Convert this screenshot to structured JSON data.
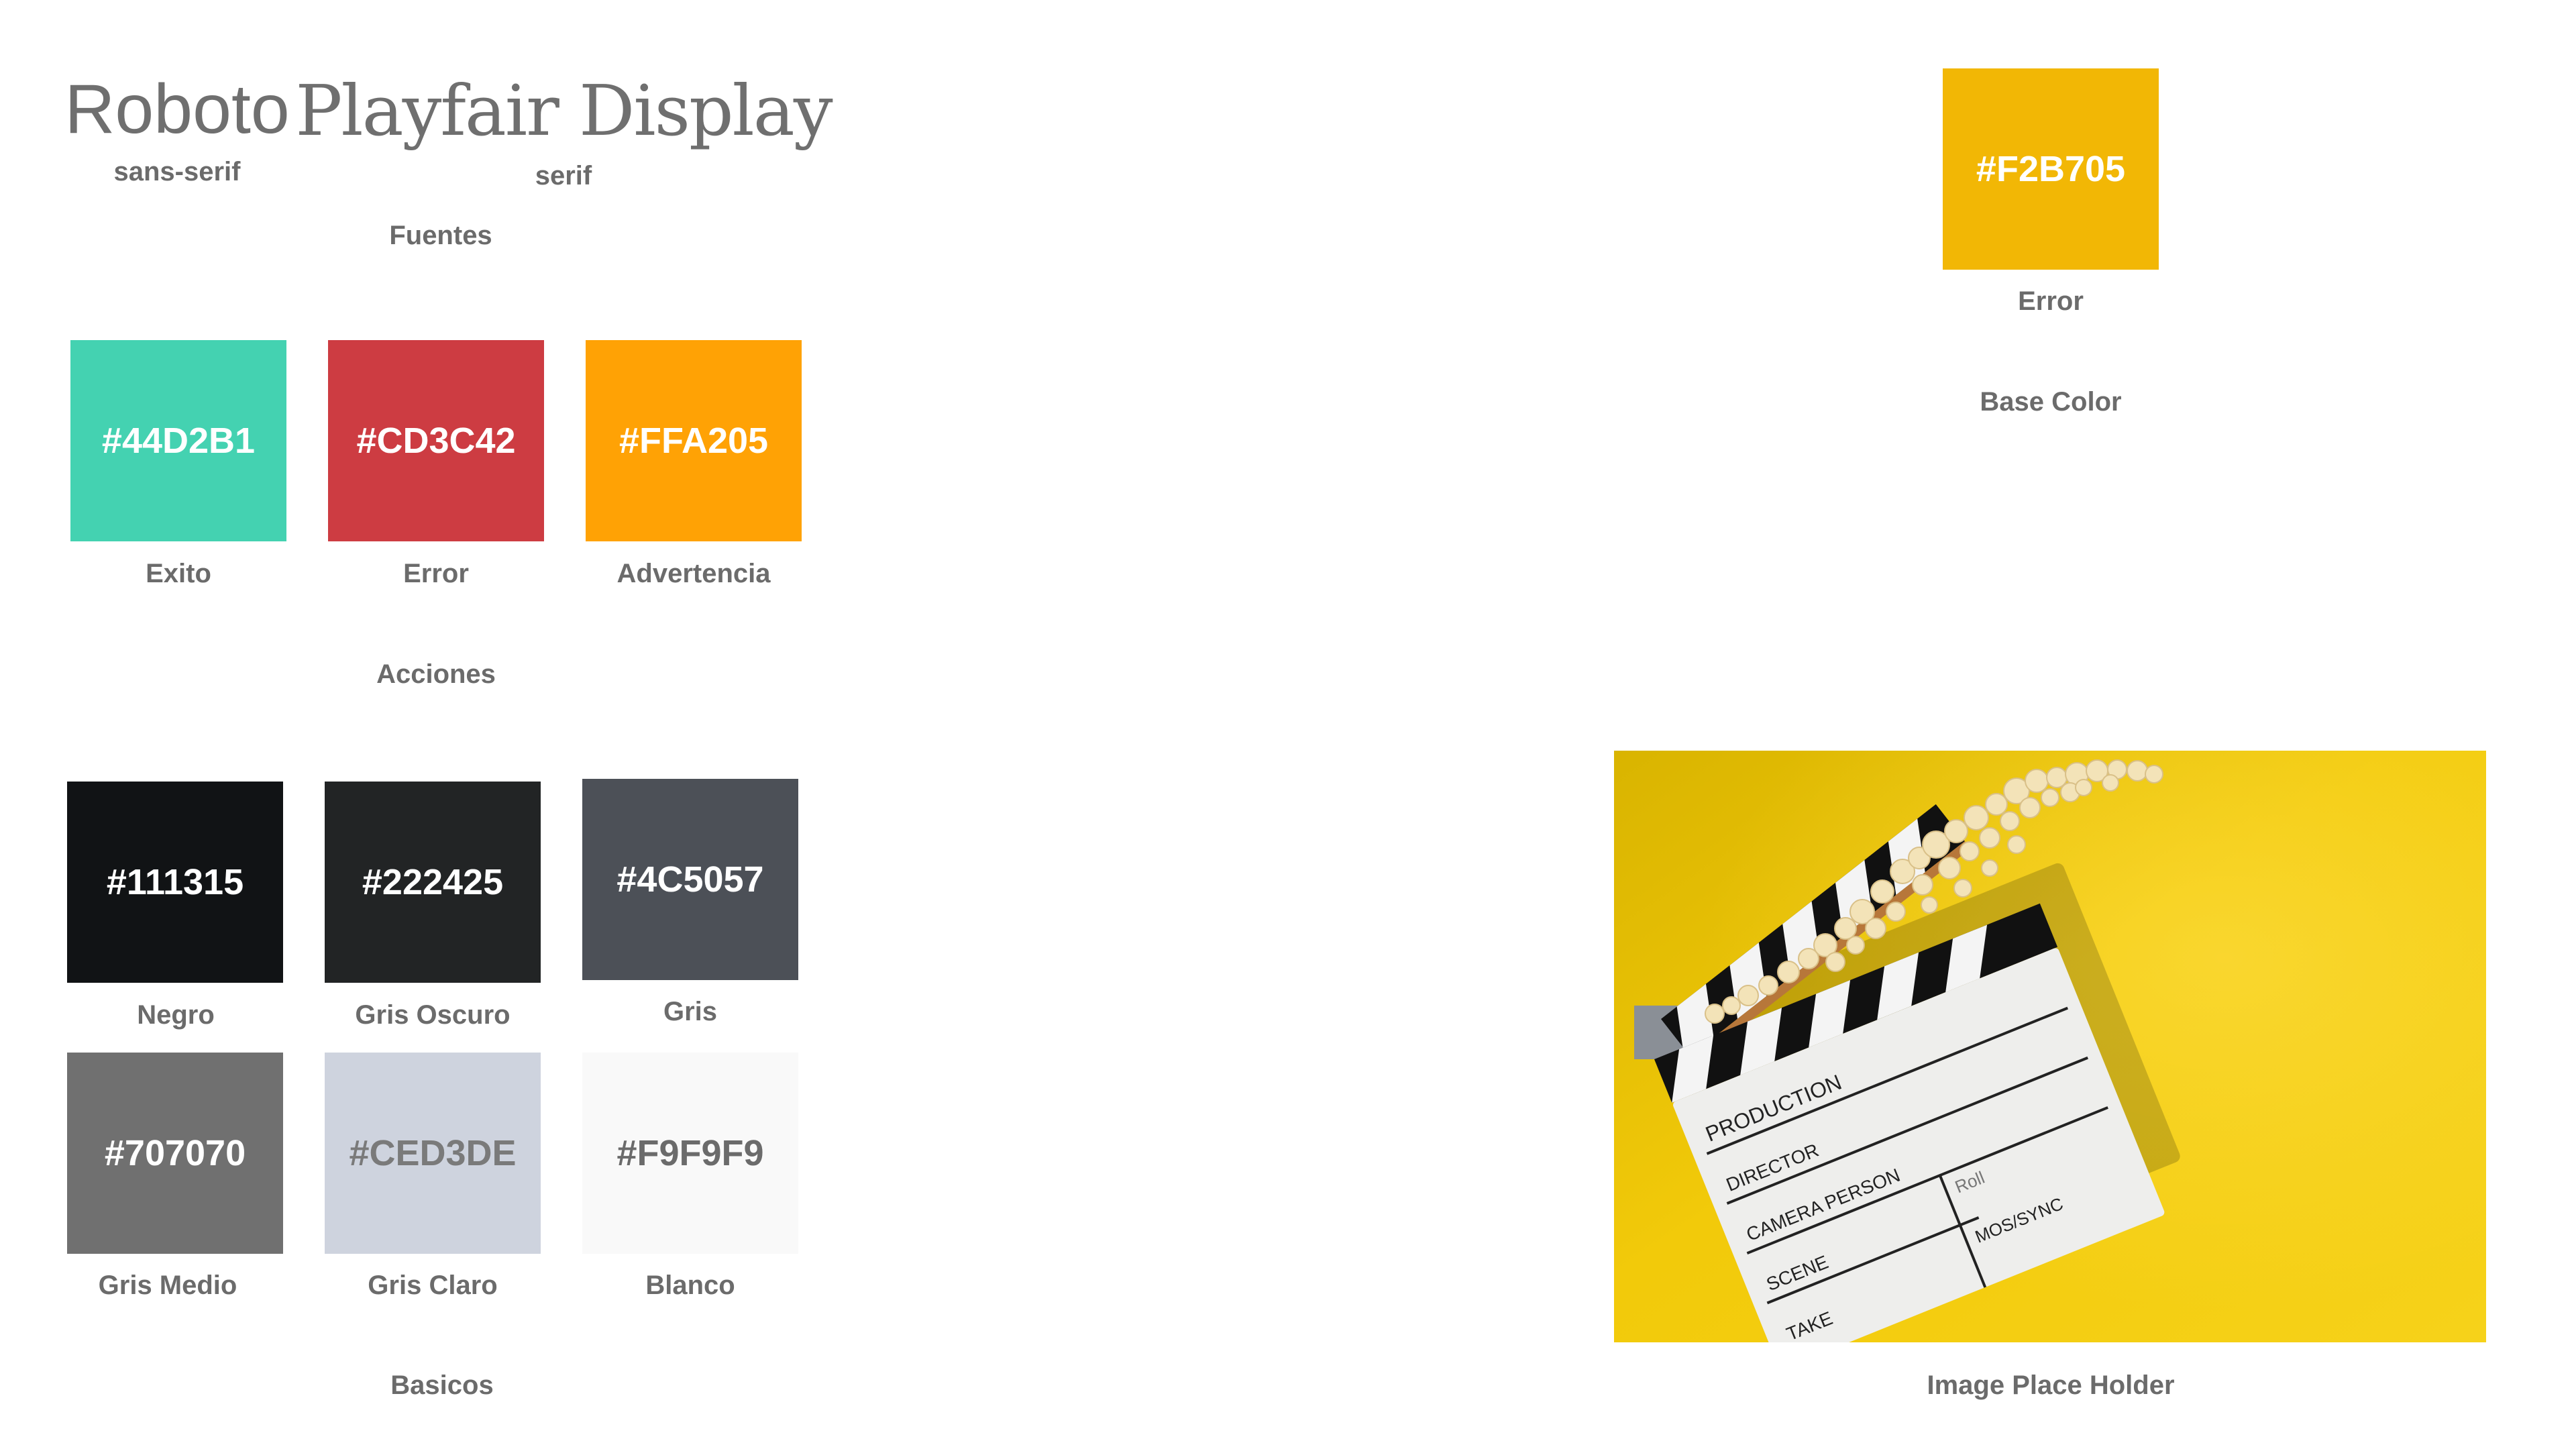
{
  "fonts": {
    "title": "Fuentes",
    "items": [
      {
        "name": "Roboto",
        "category": "sans-serif"
      },
      {
        "name": "Playfair Display",
        "category": "serif"
      }
    ]
  },
  "actions": {
    "title": "Acciones",
    "swatches": [
      {
        "hex": "#44D2B1",
        "label": "Exito",
        "color": "#44D2B1",
        "text_color": "#ffffff"
      },
      {
        "hex": "#CD3C42",
        "label": "Error",
        "color": "#CD3C42",
        "text_color": "#ffffff"
      },
      {
        "hex": "#FFA205",
        "label": "Advertencia",
        "color": "#FFA205",
        "text_color": "#ffffff"
      }
    ]
  },
  "basics": {
    "title": "Basicos",
    "swatches": [
      {
        "hex": "#111315",
        "label": "Negro",
        "color": "#111315",
        "text_color": "#ffffff"
      },
      {
        "hex": "#222425",
        "label": "Gris Oscuro",
        "color": "#222425",
        "text_color": "#ffffff"
      },
      {
        "hex": "#4C5057",
        "label": "Gris",
        "color": "#4C5057",
        "text_color": "#ffffff"
      },
      {
        "hex": "#707070",
        "label": "Gris Medio",
        "color": "#707070",
        "text_color": "#ffffff"
      },
      {
        "hex": "#CED3DE",
        "label": "Gris Claro",
        "color": "#CED3DE",
        "text_color": "#7a7a7a"
      },
      {
        "hex": "#F9F9F9",
        "label": "Blanco",
        "color": "#F9F9F9",
        "text_color": "#6b6b6b"
      }
    ]
  },
  "base_color": {
    "title": "Base Color",
    "swatch": {
      "hex": "#F2B705",
      "label": "Error",
      "color": "#F2B705",
      "text_color": "#ffffff"
    }
  },
  "image_placeholder": {
    "title": "Image Place Holder",
    "clapperboard": {
      "production": "PRODUCTION",
      "director": "DIRECTOR",
      "camera_person": "CAMERA PERSON",
      "scene": "SCENE",
      "take": "TAKE",
      "roll": "Roll",
      "mos_sync": "MOS/SYNC"
    }
  }
}
